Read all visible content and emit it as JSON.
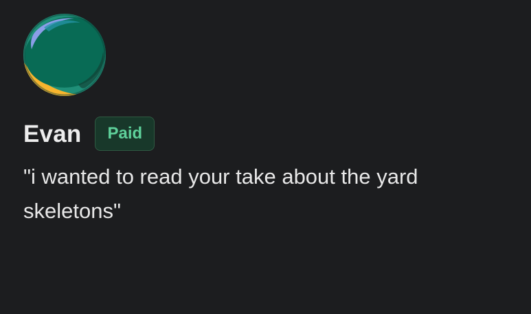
{
  "comment": {
    "author_name": "Evan",
    "badge_label": "Paid",
    "text": "\"i wanted to read your take about the yard skeletons\"",
    "avatar_icon": "circular-gradient-avatar-icon"
  },
  "colors": {
    "background": "#1c1d1f",
    "name": "#ededed",
    "badge_text": "#5ed09a",
    "badge_background": "#18382a",
    "badge_border": "#2f5a43",
    "avatar_main": "#086b55",
    "avatar_orange": "#ff6f31",
    "avatar_yellow": "#f7b52e",
    "avatar_blue": "#8b9ee8"
  }
}
